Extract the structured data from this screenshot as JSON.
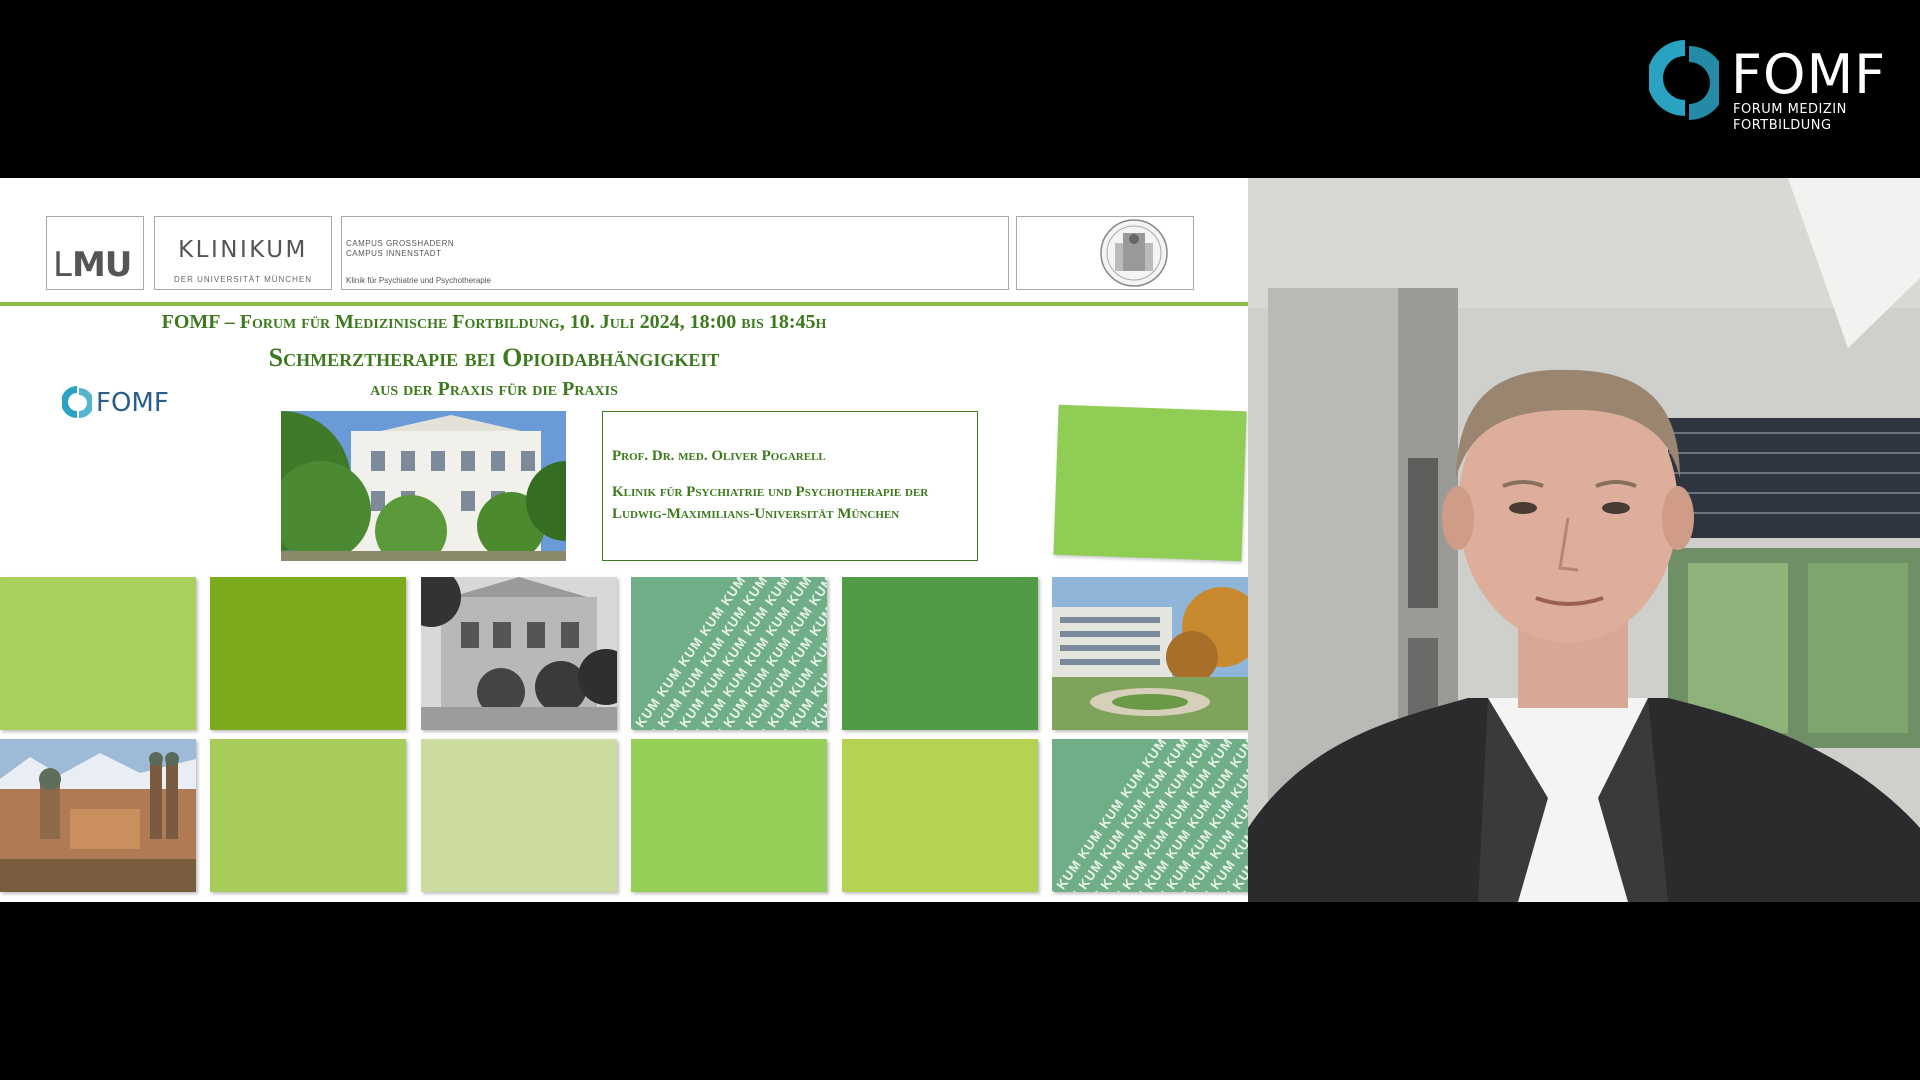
{
  "brand": {
    "logo_word": "FOMF",
    "logo_sub_line1": "FORUM MEDIZIN",
    "logo_sub_line2": "FORTBILDUNG",
    "accent": "#2aa3c3"
  },
  "slide": {
    "header": {
      "lmu_light": "L",
      "lmu_bold": "MU",
      "klinikum": "KLINIKUM",
      "klinikum_sub": "DER UNIVERSITÄT MÜNCHEN",
      "campus_1": "CAMPUS GROSSHADERN",
      "campus_2": "CAMPUS INNENSTADT",
      "clinic": "Klinik für Psychiatrie und Psychotherapie"
    },
    "title_line1": "FOMF – Forum für Medizinische Fortbildung, 10. Juli 2024, 18:00 bis 18:45h",
    "title_line2": "Schmerztherapie bei Opioidabhängigkeit",
    "title_line3": "aus der Praxis für die Praxis",
    "small_logo": "FOMF",
    "speaker_name": "Prof. Dr. med. Oliver Pogarell",
    "speaker_affil_1": "Klinik für Psychiatrie und Psychotherapie der",
    "speaker_affil_2": "Ludwig-Maximilians-Universität München",
    "kum_text": "KUM",
    "green": "#3d7a1e"
  }
}
